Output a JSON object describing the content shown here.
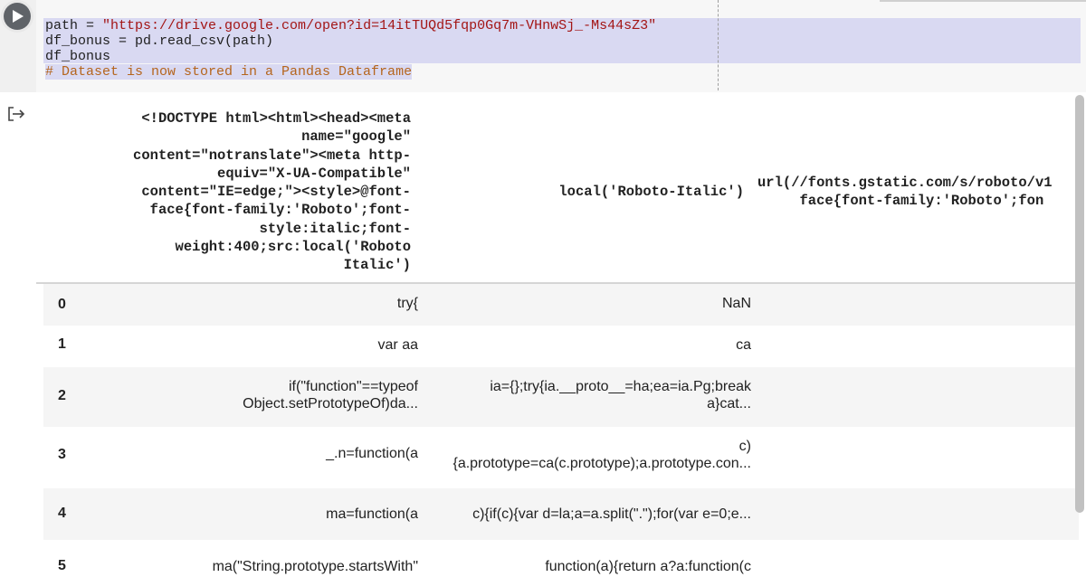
{
  "code_cell": {
    "lines": [
      {
        "prefix": "path = ",
        "string": "\"https://drive.google.com/open?id=14itTUQd5fqp0Gq7m-VHnwSj_-Ms44sZ3\""
      },
      {
        "text": "df_bonus = pd.read_csv(path)"
      },
      {
        "text": "df_bonus"
      },
      {
        "comment": "# Dataset is now stored in a Pandas Dataframe"
      }
    ]
  },
  "icons": {
    "run": "play-icon",
    "output": "output-arrow-icon"
  },
  "dataframe": {
    "columns": [
      "<!DOCTYPE html><html><head><meta\n          name=\"google\"\ncontent=\"notranslate\"><meta http-\n        equiv=\"X-UA-Compatible\"\n  content=\"IE=edge;\"><style>@font-\n   face{font-family:'Roboto';font-\n          style:italic;font-\n     weight:400;src:local('Roboto\n                       Italic')",
      "local('Roboto-Italic')",
      "url(//fonts.gstatic.com/s/roboto/v1\n     face{font-family:'Roboto';fon"
    ],
    "rows": [
      {
        "index": "0",
        "c1": "try{",
        "c2": "NaN"
      },
      {
        "index": "1",
        "c1": "var aa",
        "c2": "ca"
      },
      {
        "index": "2",
        "c1": "if(\"function\"==typeof\nObject.setPrototypeOf)da...",
        "c2": "ia={};try{ia.__proto__=ha;ea=ia.Pg;break\na}cat..."
      },
      {
        "index": "3",
        "c1": "_.n=function(a",
        "c2": "c)\n{a.prototype=ca(c.prototype);a.prototype.con..."
      },
      {
        "index": "4",
        "c1": "ma=function(a",
        "c2": "c){if(c){var d=la;a=a.split(\".\");for(var e=0;e..."
      },
      {
        "index": "5",
        "c1": "ma(\"String.prototype.startsWith\"",
        "c2": "function(a){return a?a:function(c"
      }
    ]
  }
}
